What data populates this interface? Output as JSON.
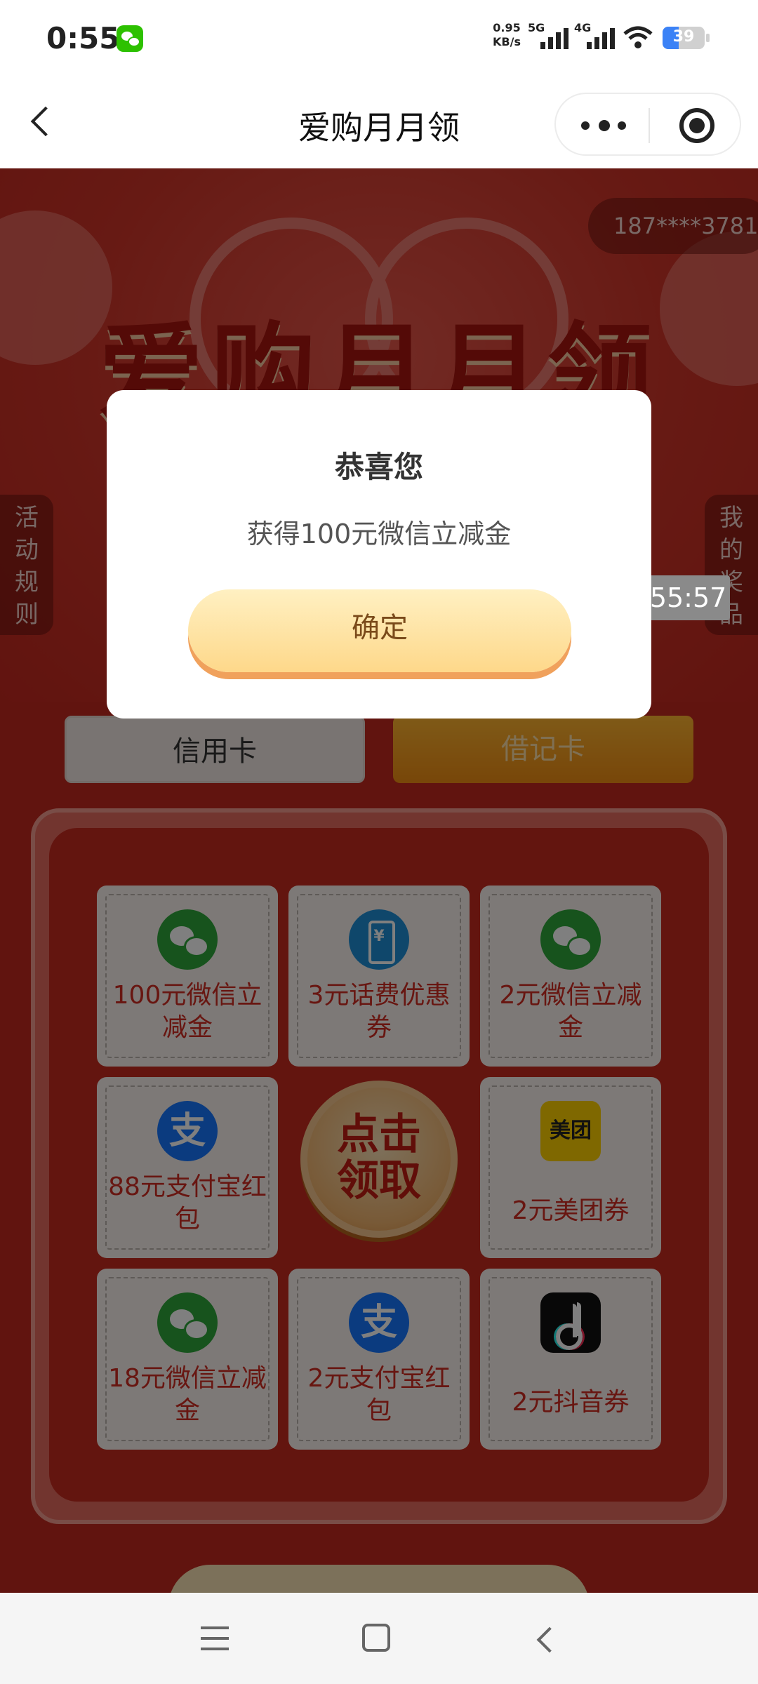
{
  "status_bar": {
    "time": "0:55",
    "net_speed_value": "0.95",
    "net_speed_unit": "KB/s",
    "signal_1_label": "5G",
    "signal_2_label": "4G",
    "battery_level": "39",
    "notification_icon": "wechat-icon"
  },
  "title_bar": {
    "title": "爱购月月领"
  },
  "campaign": {
    "banner_title": "爱购月月领",
    "phone_mask": "187****3781",
    "rules_tab": [
      "活",
      "动",
      "规",
      "则"
    ],
    "prizes_tab": [
      "我",
      "的",
      "奖",
      "品"
    ],
    "timer": "00:55:57",
    "tab_credit": "信用卡",
    "tab_debit": "借记卡",
    "prizes": [
      {
        "label_1": "100元微信立",
        "label_2": "减金",
        "icon": "wechat-icon"
      },
      {
        "label_1": "3元话费优惠",
        "label_2": "券",
        "icon": "phone-bill-icon"
      },
      {
        "label_1": "2元微信立减",
        "label_2": "金",
        "icon": "wechat-icon"
      },
      {
        "label_1": "88元支付宝红",
        "label_2": "包",
        "icon": "alipay-icon"
      },
      {
        "label_1": "2元美团券",
        "icon": "meituan-icon",
        "icon_text": "美团"
      },
      {
        "label_1": "18元微信立减",
        "label_2": "金",
        "icon": "wechat-icon"
      },
      {
        "label_1": "2元支付宝红",
        "label_2": "包",
        "icon": "alipay-icon"
      },
      {
        "label_1": "2元抖音券",
        "icon": "douyin-icon"
      }
    ],
    "draw_button_line1": "点击",
    "draw_button_line2": "领取",
    "alipay_glyph": "支"
  },
  "dialog": {
    "title": "恭喜您",
    "message": "获得100元微信立减金",
    "confirm_label": "确定"
  },
  "colors": {
    "campaign_red": "#c3281f",
    "prize_text_red": "#d02c22",
    "confirm_gold": "#fed88a",
    "debit_tab_orange": "#f08d12"
  }
}
